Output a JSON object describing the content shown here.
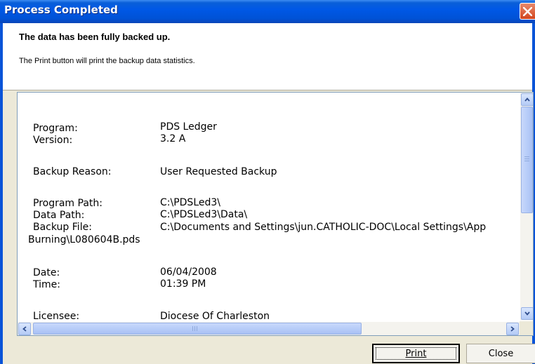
{
  "window": {
    "title": "Process Completed",
    "close_icon": "close-icon"
  },
  "header": {
    "title": "The data has been fully backed up.",
    "subtitle": "The Print button will print the backup data statistics."
  },
  "report": {
    "program_label": "Program:",
    "program_value": "PDS Ledger",
    "version_label": "Version:",
    "version_value": "3.2 A",
    "reason_label": "Backup Reason:",
    "reason_value": "User Requested Backup",
    "program_path_label": "Program Path:",
    "program_path_value": "C:\\PDSLed3\\",
    "data_path_label": "Data Path:",
    "data_path_value": "C:\\PDSLed3\\Data\\",
    "backup_file_label": "Backup File:",
    "backup_file_value": "C:\\Documents and Settings\\jun.CATHOLIC-DOC\\Local Settings\\App",
    "backup_file_wrap": "Burning\\L080604B.pds",
    "date_label": "Date:",
    "date_value": "06/04/2008",
    "time_label": "Time:",
    "time_value": "01:39 PM",
    "licensee_label": "Licensee:",
    "licensee_value": "Diocese Of Charleston"
  },
  "buttons": {
    "print": "Print",
    "close": "Close"
  },
  "colors": {
    "titlebar": "#0058e6",
    "dialog_bg": "#ece9d8",
    "close_button": "#d3461e"
  }
}
